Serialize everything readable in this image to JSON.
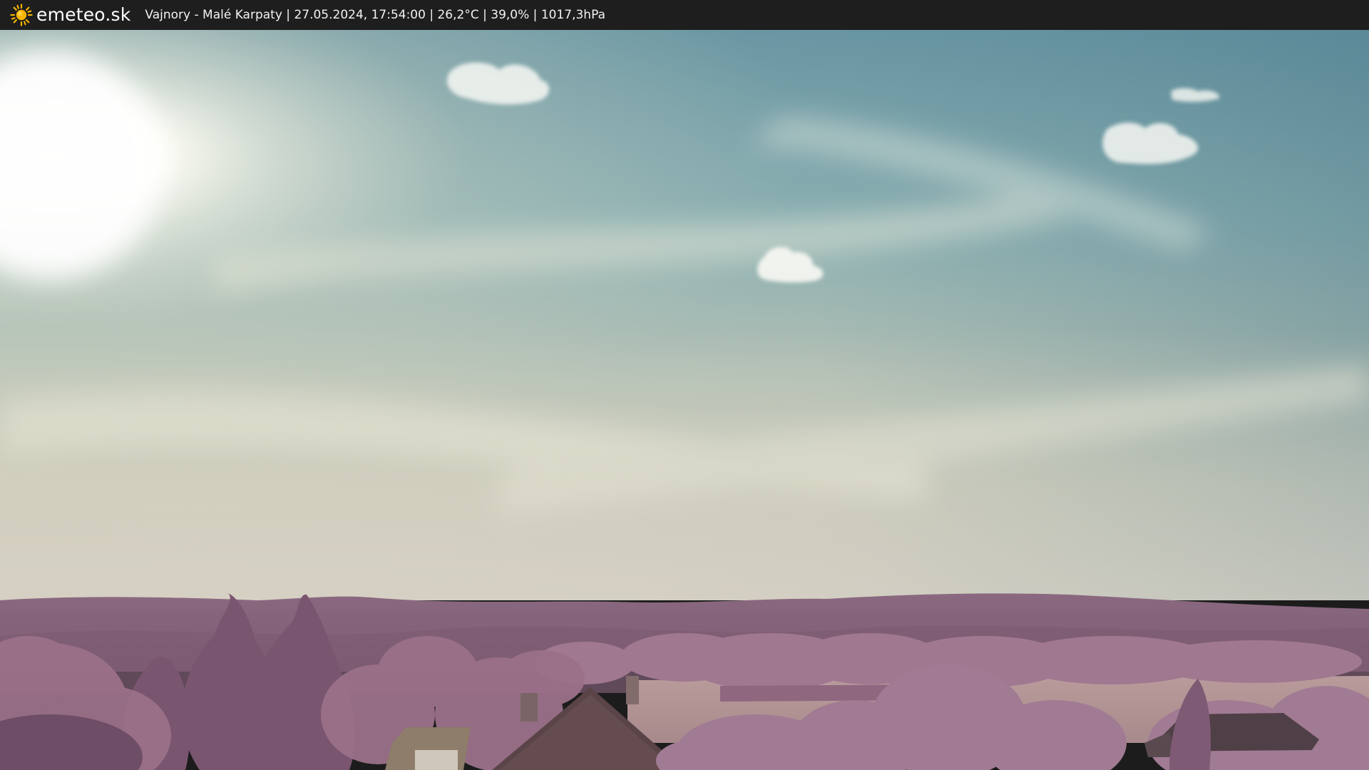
{
  "header": {
    "brand": "emeteo.sk",
    "location": "Vajnory - Malé Karpaty",
    "datetime": "27.05.2024, 17:54:00",
    "temperature": "26,2°C",
    "humidity": "39,0%",
    "pressure": "1017,3hPa",
    "separator": " | ",
    "logo_icon": "sun-icon",
    "logo_color": "#f5b400"
  },
  "webcam": {
    "image_icon": "webcam-photo",
    "sky_color_top": "#6f9aa6",
    "sky_color_horizon": "#c9c8b6",
    "vegetation_color": "#9a6f8c"
  }
}
